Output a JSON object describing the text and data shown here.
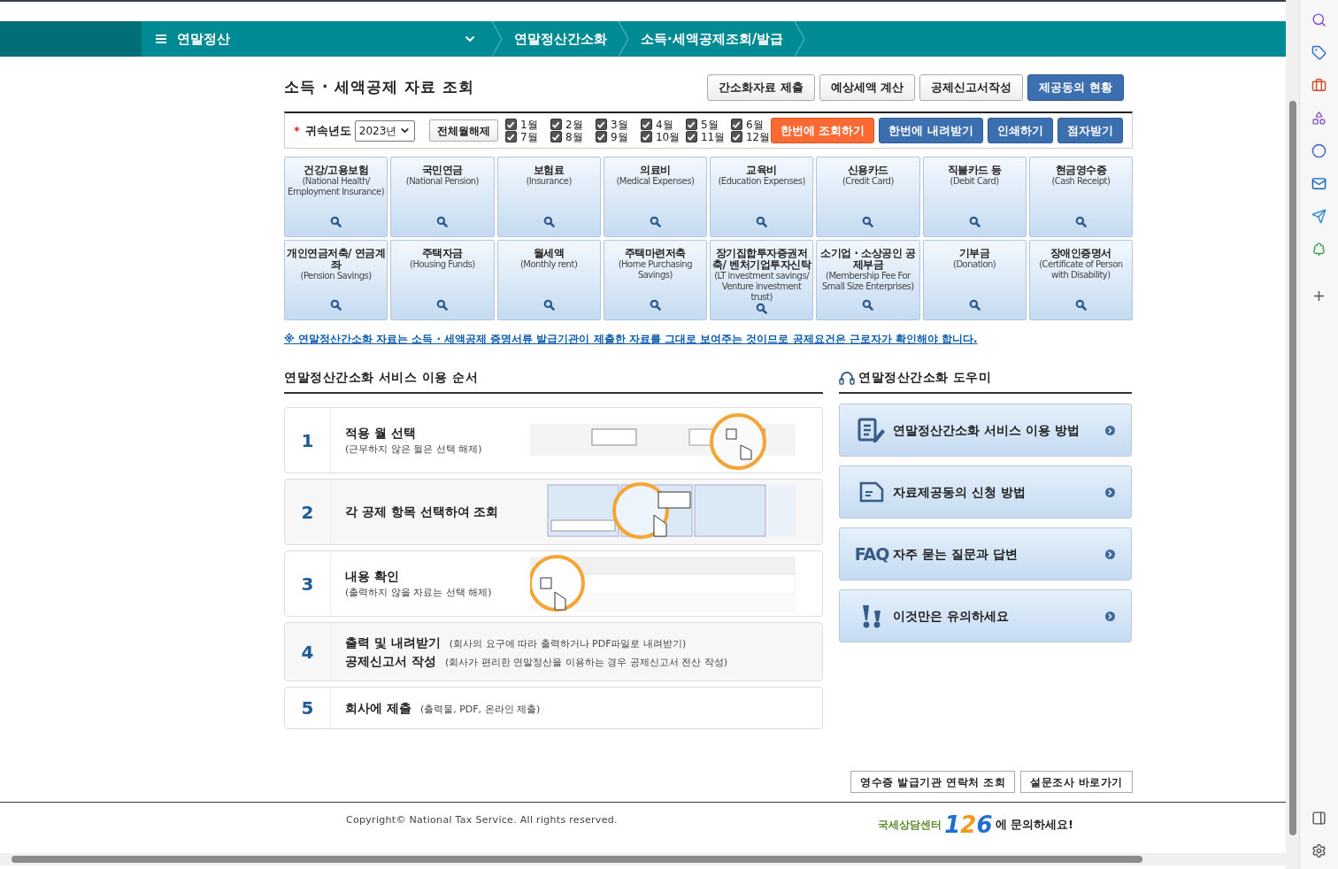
{
  "nav": {
    "menu_label": "연말정산",
    "crumbs": [
      "연말정산간소화",
      "소득·세액공제조회/발급"
    ]
  },
  "page_title": "소득 · 세액공제 자료 조회",
  "top_buttons": [
    {
      "label": "간소화자료 제출",
      "kind": "default"
    },
    {
      "label": "예상세액 계산",
      "kind": "default"
    },
    {
      "label": "공제신고서작성",
      "kind": "default"
    },
    {
      "label": "제공동의 현황",
      "kind": "primary"
    }
  ],
  "filter": {
    "required_mark": "*",
    "year_label": "귀속년도",
    "year_value": "2023년",
    "clear_button": "전체월해제",
    "months": [
      {
        "label": "1월",
        "checked": true
      },
      {
        "label": "2월",
        "checked": true
      },
      {
        "label": "3월",
        "checked": true
      },
      {
        "label": "4월",
        "checked": true
      },
      {
        "label": "5월",
        "checked": true
      },
      {
        "label": "6월",
        "checked": true
      },
      {
        "label": "7월",
        "checked": true
      },
      {
        "label": "8월",
        "checked": true
      },
      {
        "label": "9월",
        "checked": true
      },
      {
        "label": "10월",
        "checked": true
      },
      {
        "label": "11월",
        "checked": true
      },
      {
        "label": "12월",
        "checked": true
      }
    ],
    "actions": [
      {
        "label": "한번에 조회하기",
        "kind": "accent"
      },
      {
        "label": "한번에 내려받기",
        "kind": "primary"
      },
      {
        "label": "인쇄하기",
        "kind": "primary"
      },
      {
        "label": "점자받기",
        "kind": "primary"
      }
    ]
  },
  "categories": [
    {
      "title": "건강/고용보험",
      "subtitle": "(National Health/ Employment Insurance)"
    },
    {
      "title": "국민연금",
      "subtitle": "(National Pension)"
    },
    {
      "title": "보험료",
      "subtitle": "(Insurance)"
    },
    {
      "title": "의료비",
      "subtitle": "(Medical Expenses)"
    },
    {
      "title": "교육비",
      "subtitle": "(Education Expenses)"
    },
    {
      "title": "신용카드",
      "subtitle": "(Credit Card)"
    },
    {
      "title": "직불카드 등",
      "subtitle": "(Debit Card)"
    },
    {
      "title": "현금영수증",
      "subtitle": "(Cash Receipt)"
    },
    {
      "title": "개인연금저축/ 연금계좌",
      "subtitle": "(Pension Savings)"
    },
    {
      "title": "주택자금",
      "subtitle": "(Housing Funds)"
    },
    {
      "title": "월세액",
      "subtitle": "(Monthly rent)"
    },
    {
      "title": "주택마련저축",
      "subtitle": "(Home Purchasing Savings)"
    },
    {
      "title": "장기집합투자증권저축/ 벤처기업투자신탁",
      "subtitle": "(LT investment savings/ Venture investment trust)"
    },
    {
      "title": "소기업 · 소상공인 공제부금",
      "subtitle": "(Membership Fee For Small Size Enterprises)"
    },
    {
      "title": "기부금",
      "subtitle": "(Donation)"
    },
    {
      "title": "장애인증명서",
      "subtitle": "(Certificate of Person with Disability)"
    }
  ],
  "notice": "※ 연말정산간소화 자료는 소득 · 세액공제 증명서류 발급기관이 제출한 자료를 그대로 보여주는 것이므로 공제요건은 근로자가 확인해야 합니다.",
  "steps_heading": "연말정산간소화 서비스 이용 순서",
  "steps": [
    {
      "number": "1",
      "illustrated": true,
      "lines": [
        {
          "title": "적용 월 선택",
          "note": "(근무하지 않은 월은 선택 해제)"
        }
      ]
    },
    {
      "number": "2",
      "illustrated": true,
      "lines": [
        {
          "title": "각 공제 항목 선택하여 조회"
        }
      ]
    },
    {
      "number": "3",
      "illustrated": true,
      "lines": [
        {
          "title": "내용 확인",
          "note": "(출력하지 않을 자료는 선택 해제)"
        }
      ]
    },
    {
      "number": "4",
      "illustrated": false,
      "lines": [
        {
          "title": "출력 및 내려받기",
          "note": "(회사의 요구에 따라 출력하거나 PDF파일로 내려받기)"
        },
        {
          "title": "공제신고서 작성",
          "note": "(회사가 편리한 연말정산을 이용하는 경우 공제신고서 전산 작성)"
        }
      ]
    },
    {
      "number": "5",
      "illustrated": false,
      "lines": [
        {
          "title": "회사에 제출",
          "note": "(출력물, PDF, 온라인 제출)"
        }
      ]
    }
  ],
  "helper_heading": "연말정산간소화 도우미",
  "helpers": [
    {
      "label": "연말정산간소화 서비스 이용 방법",
      "kind": "document-pen"
    },
    {
      "label": "자료제공동의 신청 방법",
      "kind": "document"
    },
    {
      "label": "자주 묻는 질문과 답변",
      "kind": "faq",
      "badge": "FAQ"
    },
    {
      "label": "이것만은 유의하세요",
      "kind": "exclamation"
    }
  ],
  "bottom_buttons": [
    "영수증 발급기관 연락처 조회",
    "설문조사 바로가기"
  ],
  "footer": {
    "copyright": "Copyright© National Tax Service. All rights reserved.",
    "center_name": "국세상담센터",
    "center_number": [
      "1",
      "2",
      "6"
    ],
    "center_suffix": "에 문의하세요!"
  }
}
